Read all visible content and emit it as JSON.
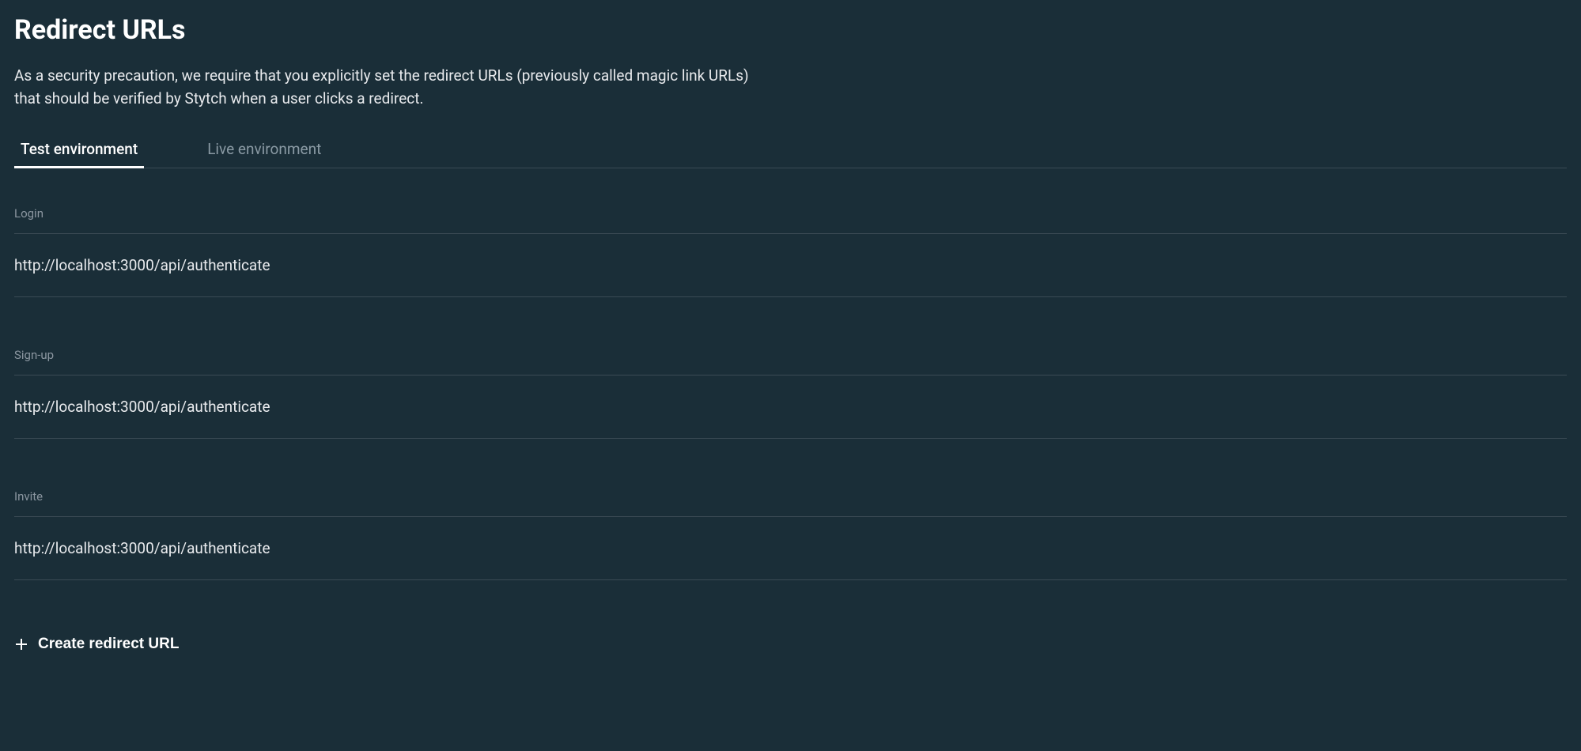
{
  "header": {
    "title": "Redirect URLs",
    "description": "As a security precaution, we require that you explicitly set the redirect URLs (previously called magic link URLs) that should be verified by Stytch when a user clicks a redirect."
  },
  "tabs": {
    "test": "Test environment",
    "live": "Live environment"
  },
  "sections": [
    {
      "label": "Login",
      "url": "http://localhost:3000/api/authenticate"
    },
    {
      "label": "Sign-up",
      "url": "http://localhost:3000/api/authenticate"
    },
    {
      "label": "Invite",
      "url": "http://localhost:3000/api/authenticate"
    }
  ],
  "actions": {
    "create": "Create redirect URL"
  }
}
